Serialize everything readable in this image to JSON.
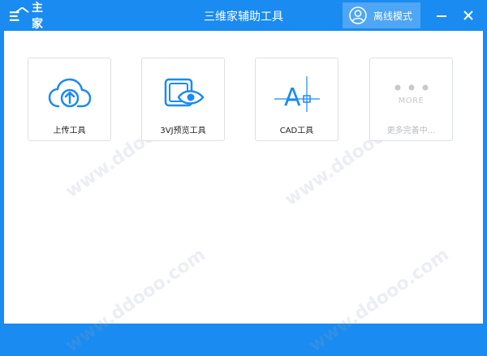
{
  "app": {
    "logo_text": "主家",
    "title": "三维家辅助工具",
    "mode_label": "离线模式",
    "minimize_icon": "minimize-icon",
    "close_icon": "close-icon"
  },
  "colors": {
    "accent": "#1a8bf0",
    "mode_button_bg": "#4ea6f4",
    "icon_blue": "#1a8bf0",
    "disabled_gray": "#c6c9cd"
  },
  "tools": [
    {
      "label": "上传工具",
      "icon": "cloud-upload-icon"
    },
    {
      "label": "3VJ预览工具",
      "icon": "preview-eye-icon"
    },
    {
      "label": "CAD工具",
      "icon": "cad-icon"
    },
    {
      "label": "更多完善中...",
      "icon": "more-icon",
      "icon_text": "MORE",
      "disabled": true
    }
  ]
}
